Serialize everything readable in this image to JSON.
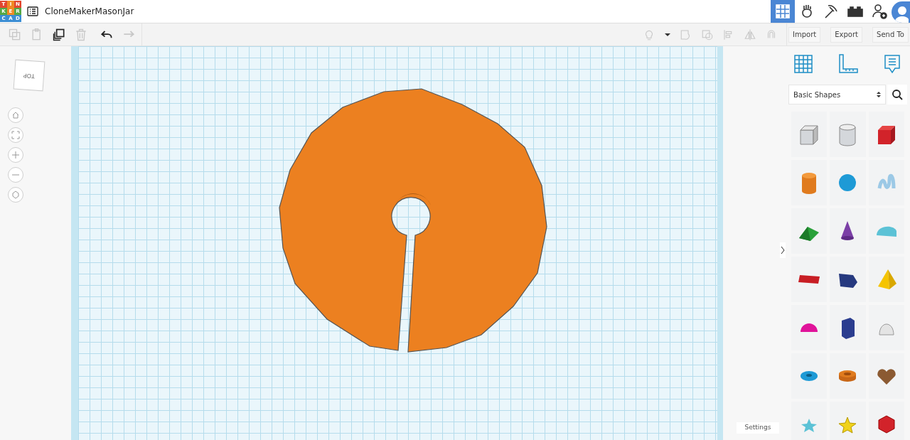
{
  "logo": {
    "letters": [
      {
        "char": "T",
        "color": "#e2462f"
      },
      {
        "char": "I",
        "color": "#f08a24"
      },
      {
        "char": "N",
        "color": "#e2462f"
      },
      {
        "char": "K",
        "color": "#55a846"
      },
      {
        "char": "E",
        "color": "#f08a24"
      },
      {
        "char": "R",
        "color": "#55a846"
      },
      {
        "char": "C",
        "color": "#3c8ed4"
      },
      {
        "char": "A",
        "color": "#3c8ed4"
      },
      {
        "char": "D",
        "color": "#3c8ed4"
      }
    ]
  },
  "project": {
    "title": "CloneMakerMasonJar"
  },
  "nav": [
    {
      "kind": "grid",
      "selected": true
    },
    {
      "kind": "circuits",
      "selected": false
    },
    {
      "kind": "pickaxe",
      "selected": false
    },
    {
      "kind": "bricks",
      "selected": false
    },
    {
      "kind": "add-user",
      "selected": false
    }
  ],
  "toolbar": [
    {
      "kind": "copy",
      "disabled": true
    },
    {
      "kind": "paste",
      "disabled": true
    },
    {
      "kind": "duplicate",
      "disabled": false
    },
    {
      "kind": "delete",
      "disabled": true
    },
    {
      "kind": "undo",
      "disabled": false
    },
    {
      "kind": "redo",
      "disabled": true
    }
  ],
  "actions": [
    "Import",
    "Export",
    "Send To"
  ],
  "view_cube": {
    "label": "TOP"
  },
  "panel": {
    "category": "Basic Shapes"
  },
  "shapes": [
    {
      "kind": "box-hole"
    },
    {
      "kind": "cylinder-hole"
    },
    {
      "kind": "box"
    },
    {
      "kind": "cylinder"
    },
    {
      "kind": "sphere"
    },
    {
      "kind": "scribble"
    },
    {
      "kind": "roof"
    },
    {
      "kind": "cone"
    },
    {
      "kind": "round-roof"
    },
    {
      "kind": "text"
    },
    {
      "kind": "wedge"
    },
    {
      "kind": "pyramid"
    },
    {
      "kind": "half-sphere"
    },
    {
      "kind": "polygon"
    },
    {
      "kind": "paraboloid"
    },
    {
      "kind": "torus"
    },
    {
      "kind": "tube"
    },
    {
      "kind": "heart"
    },
    {
      "kind": "star"
    },
    {
      "kind": "star-yellow"
    },
    {
      "kind": "icosahedron"
    }
  ],
  "settings": "Settings"
}
